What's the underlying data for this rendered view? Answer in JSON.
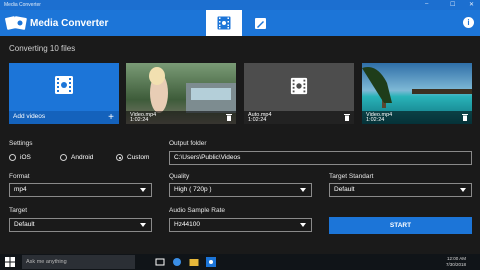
{
  "window": {
    "title": "Media Converter",
    "controls": [
      "–",
      "☐",
      "✕"
    ]
  },
  "header": {
    "app_name": "Media Converter",
    "info": "i",
    "tabs": [
      "convert-tab",
      "edit-tab"
    ]
  },
  "main": {
    "converting_title": "Converting 10 files",
    "add_videos_label": "Add videos",
    "add_plus": "+",
    "files": [
      {
        "name": "Video.mp4",
        "duration": "1:02:24"
      },
      {
        "name": "Auto.mp4",
        "duration": "1:02:24"
      },
      {
        "name": "Video.mp4",
        "duration": "1:02:24"
      }
    ]
  },
  "settings": {
    "settings_label": "Settings",
    "radios": [
      {
        "label": "iOS",
        "selected": false
      },
      {
        "label": "Android",
        "selected": false
      },
      {
        "label": "Custom",
        "selected": true
      }
    ],
    "output_folder_label": "Output folder",
    "output_folder_value": "C:\\Users\\Public\\Videos",
    "format_label": "Format",
    "format_value": "mp4",
    "quality_label": "Quality",
    "quality_value": "High ( 720p )",
    "target_standart_label": "Target Standart",
    "target_standart_value": "Default",
    "target_label": "Target",
    "target_value": "Default",
    "sample_rate_label": "Audio Sample Rate",
    "sample_rate_value": "Hz44100",
    "start_label": "START"
  },
  "taskbar": {
    "search_placeholder": "Ask me anything",
    "time": "12:00 AM",
    "date": "7/30/2018"
  },
  "colors": {
    "accent": "#1c75d8",
    "background": "#1a1a1a"
  }
}
